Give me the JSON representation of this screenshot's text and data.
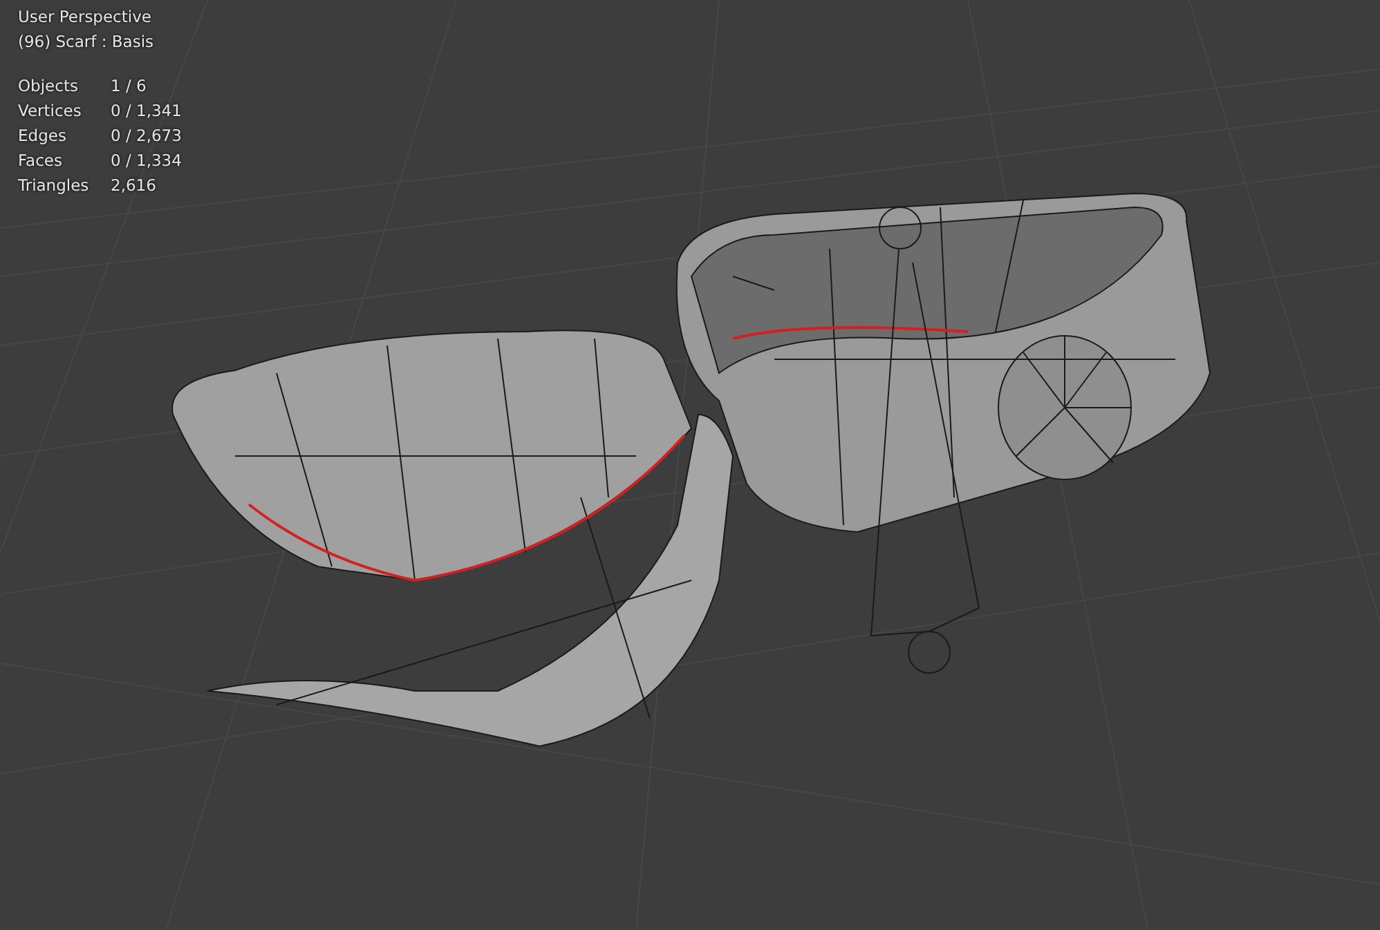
{
  "viewport": {
    "view_name": "User Perspective",
    "object_info": "(96) Scarf : Basis",
    "stats": [
      {
        "label": "Objects",
        "value": "1 / 6"
      },
      {
        "label": "Vertices",
        "value": "0 / 1,341"
      },
      {
        "label": "Edges",
        "value": "0 / 2,673"
      },
      {
        "label": "Faces",
        "value": "0 / 1,334"
      },
      {
        "label": "Triangles",
        "value": "2,616"
      }
    ]
  }
}
